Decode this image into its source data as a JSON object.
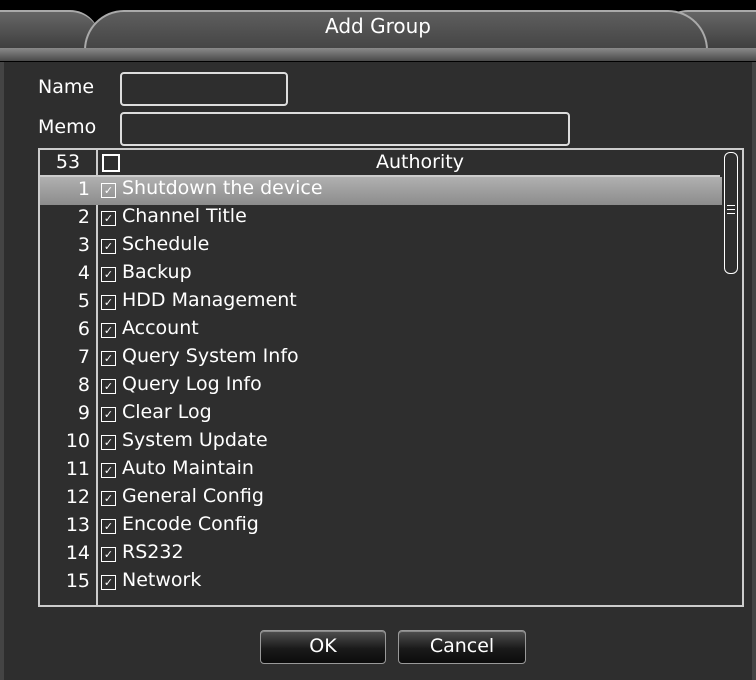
{
  "window": {
    "title": "Add Group"
  },
  "form": {
    "name_label": "Name",
    "name_value": "",
    "memo_label": "Memo",
    "memo_value": ""
  },
  "list": {
    "count": "53",
    "header_label": "Authority",
    "rows": [
      {
        "num": "1",
        "label": "Shutdown the device",
        "checked": true,
        "selected": true
      },
      {
        "num": "2",
        "label": "Channel Title",
        "checked": true
      },
      {
        "num": "3",
        "label": "Schedule",
        "checked": true
      },
      {
        "num": "4",
        "label": "Backup",
        "checked": true
      },
      {
        "num": "5",
        "label": "HDD Management",
        "checked": true
      },
      {
        "num": "6",
        "label": "Account",
        "checked": true
      },
      {
        "num": "7",
        "label": "Query System Info",
        "checked": true
      },
      {
        "num": "8",
        "label": "Query Log Info",
        "checked": true
      },
      {
        "num": "9",
        "label": "Clear Log",
        "checked": true
      },
      {
        "num": "10",
        "label": "System Update",
        "checked": true
      },
      {
        "num": "11",
        "label": "Auto Maintain",
        "checked": true
      },
      {
        "num": "12",
        "label": "General Config",
        "checked": true
      },
      {
        "num": "13",
        "label": "Encode Config",
        "checked": true
      },
      {
        "num": "14",
        "label": "RS232",
        "checked": true
      },
      {
        "num": "15",
        "label": "Network",
        "checked": true
      }
    ]
  },
  "buttons": {
    "ok": "OK",
    "cancel": "Cancel"
  }
}
